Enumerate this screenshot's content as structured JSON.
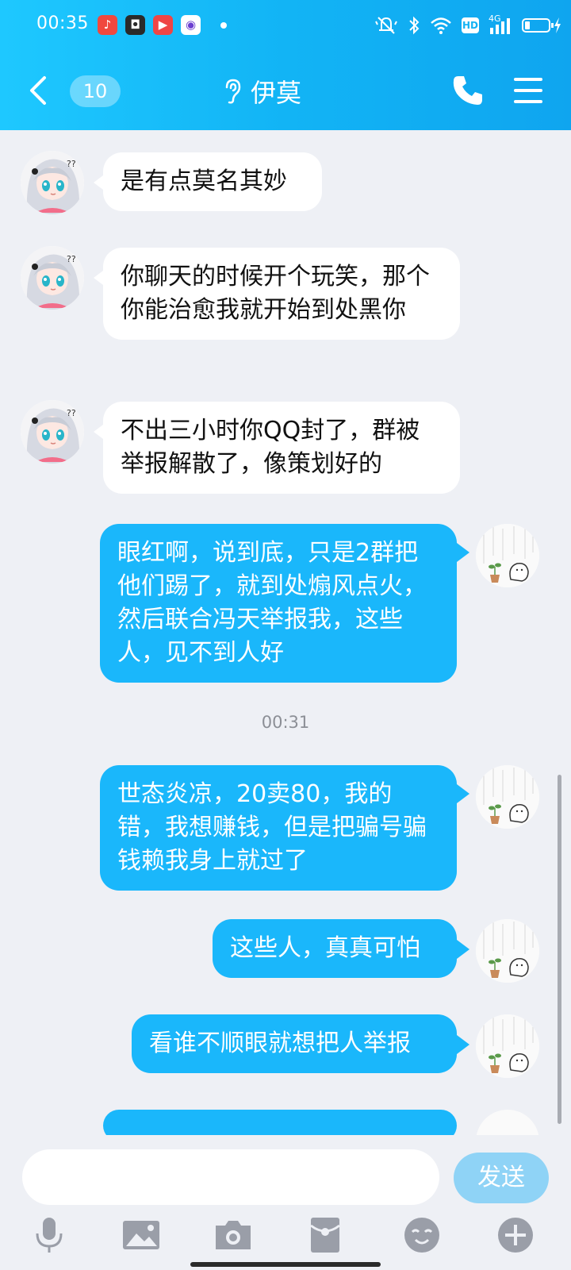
{
  "status_bar": {
    "time": "00:35",
    "network": "4G",
    "hd": "HD"
  },
  "nav": {
    "unread_count": "10",
    "contact_name": "伊莫"
  },
  "messages": [
    {
      "side": "in",
      "text": "是有点莫名其妙"
    },
    {
      "side": "in",
      "text": "你聊天的时候开个玩笑，那个你能治愈我就开始到处黑你"
    },
    {
      "side": "in",
      "text": "不出三小时你QQ封了，群被举报解散了，像策划好的"
    },
    {
      "side": "out",
      "text": "眼红啊，说到底，只是2群把他们踢了，就到处煽风点火，然后联合冯天举报我，这些人，见不到人好"
    },
    {
      "side": "time",
      "text": "00:31"
    },
    {
      "side": "out",
      "text": "世态炎凉，20卖80，我的错，我想赚钱，但是把骗号骗钱赖我身上就过了"
    },
    {
      "side": "out",
      "text": "这些人，真真可怕"
    },
    {
      "side": "out",
      "text": "看谁不顺眼就想把人举报"
    }
  ],
  "input": {
    "value": "",
    "send_label": "发送"
  },
  "colors": {
    "header": "#12b4f5",
    "out_bubble": "#1ab7fb",
    "in_bubble": "#ffffff",
    "background": "#eef0f5"
  },
  "icons": [
    "back-icon",
    "ear-icon",
    "phone-icon",
    "menu-icon",
    "mic-icon",
    "image-icon",
    "camera-icon",
    "red-packet-icon",
    "emoji-icon",
    "plus-icon"
  ]
}
